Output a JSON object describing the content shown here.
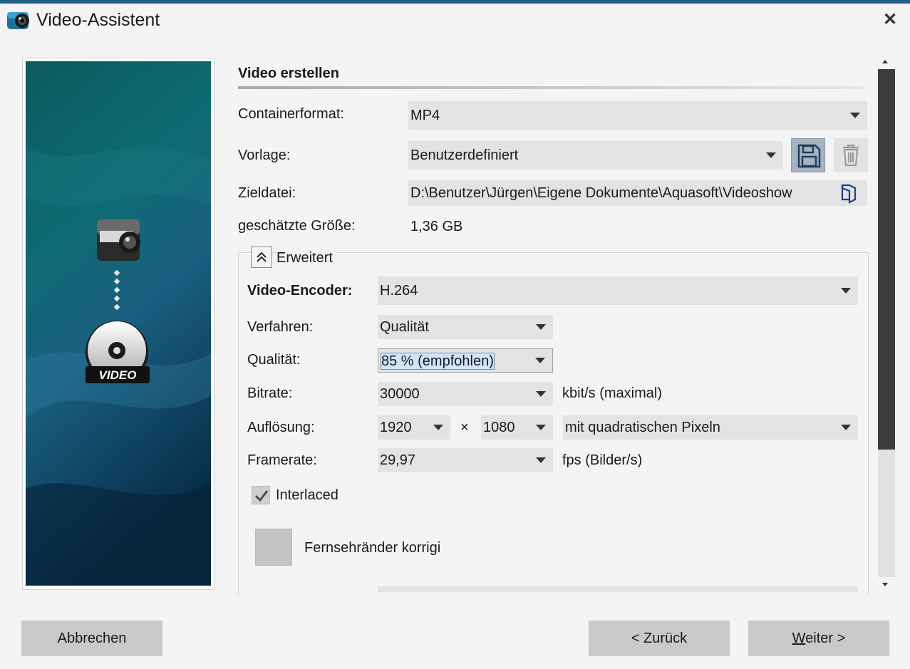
{
  "window": {
    "title": "Video-Assistent",
    "close_label": "✕"
  },
  "section": {
    "title": "Video erstellen"
  },
  "fields": {
    "container_label": "Containerformat:",
    "container_value": "MP4",
    "template_label": "Vorlage:",
    "template_value": "Benutzerdefiniert",
    "target_label": "Zieldatei:",
    "target_value": "D:\\Benutzer\\Jürgen\\Eigene Dokumente\\Aquasoft\\Videoshow",
    "size_label": "geschätzte Größe:",
    "size_value": "1,36 GB"
  },
  "advanced": {
    "toggle_label": "Erweitert",
    "encoder_label": "Video-Encoder:",
    "encoder_value": "H.264",
    "method_label": "Verfahren:",
    "method_value": "Qualität",
    "quality_label": "Qualität:",
    "quality_value": "85 % (empfohlen)",
    "bitrate_label": "Bitrate:",
    "bitrate_value": "30000",
    "bitrate_unit": "kbit/s (maximal)",
    "resolution_label": "Auflösung:",
    "resolution_width": "1920",
    "resolution_times": "×",
    "resolution_height": "1080",
    "pixel_value": "mit quadratischen Pixeln",
    "framerate_label": "Framerate:",
    "framerate_value": "29,97",
    "framerate_unit": "fps (Bilder/s)",
    "interlaced_label": "Interlaced",
    "interlaced_checked": true,
    "tv_border_label": "Fernsehränder korrigi"
  },
  "preview": {
    "badge_text": "VIDEO"
  },
  "buttons": {
    "cancel": "Abbrechen",
    "back": "< Zurück",
    "next_underline": "W",
    "next_rest": "eiter >"
  },
  "icons": {
    "app": "camera-lens-icon",
    "save": "floppy-disk-icon",
    "delete": "trash-icon",
    "browse": "folder-browse-icon",
    "collapse": "double-chevron-up-icon"
  },
  "colors": {
    "accent": "#1d5f86",
    "dropdown_bg": "#e3e3e3",
    "selection": "#cfe5f9",
    "scroll_thumb": "#3d3d3d"
  }
}
